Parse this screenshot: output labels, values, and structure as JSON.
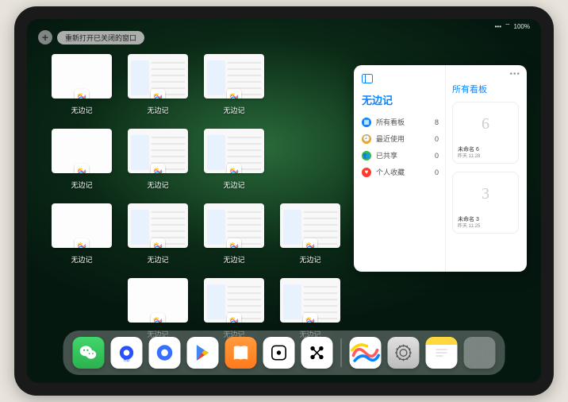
{
  "status": {
    "signal": "•••",
    "wifi": "⌔",
    "battery": "100%"
  },
  "topbar": {
    "plus": "+",
    "reopen": "重新打开已关闭的窗口"
  },
  "switcher": {
    "appName": "无边记",
    "cards": [
      {
        "label": "无边记",
        "variant": "blank"
      },
      {
        "label": "无边记",
        "variant": "full"
      },
      {
        "label": "无边记",
        "variant": "full"
      },
      {
        "label": "无边记",
        "variant": "blank"
      },
      {
        "label": "无边记",
        "variant": "full"
      },
      {
        "label": "无边记",
        "variant": "full"
      },
      {
        "label": "无边记",
        "variant": "blank"
      },
      {
        "label": "无边记",
        "variant": "full"
      },
      {
        "label": "无边记",
        "variant": "full"
      },
      {
        "label": "无边记",
        "variant": "full"
      },
      {
        "label": "无边记",
        "variant": "blank"
      },
      {
        "label": "无边记",
        "variant": "full"
      },
      {
        "label": "无边记",
        "variant": "full"
      }
    ]
  },
  "popover": {
    "title": "无边记",
    "rightTitle": "所有看板",
    "more": "•••",
    "filters": [
      {
        "icon": "grid",
        "color": "#0a84ff",
        "label": "所有看板",
        "count": "8"
      },
      {
        "icon": "clock",
        "color": "#ff9f0a",
        "label": "最近使用",
        "count": "0"
      },
      {
        "icon": "people",
        "color": "#30c048",
        "label": "已共享",
        "count": "0"
      },
      {
        "icon": "heart",
        "color": "#ff3b30",
        "label": "个人收藏",
        "count": "0"
      }
    ],
    "boards": [
      {
        "glyph": "6",
        "name": "未命名 6",
        "time": "昨天 11:28"
      },
      {
        "glyph": "3",
        "name": "未命名 3",
        "time": "昨天 11:25"
      }
    ]
  },
  "dock": {
    "apps": [
      {
        "key": "wechat",
        "name": "wechat-icon"
      },
      {
        "key": "quark-hd",
        "name": "quark-hd-icon"
      },
      {
        "key": "quark",
        "name": "quark-icon"
      },
      {
        "key": "play",
        "name": "play-store-icon"
      },
      {
        "key": "books",
        "name": "books-icon"
      },
      {
        "key": "dice",
        "name": "dice-icon"
      },
      {
        "key": "matrix",
        "name": "matrix-icon"
      }
    ],
    "recents": [
      {
        "key": "freeform",
        "name": "freeform-icon"
      },
      {
        "key": "settings",
        "name": "settings-icon"
      },
      {
        "key": "notes",
        "name": "notes-icon"
      },
      {
        "key": "library",
        "name": "app-library-icon"
      }
    ]
  }
}
